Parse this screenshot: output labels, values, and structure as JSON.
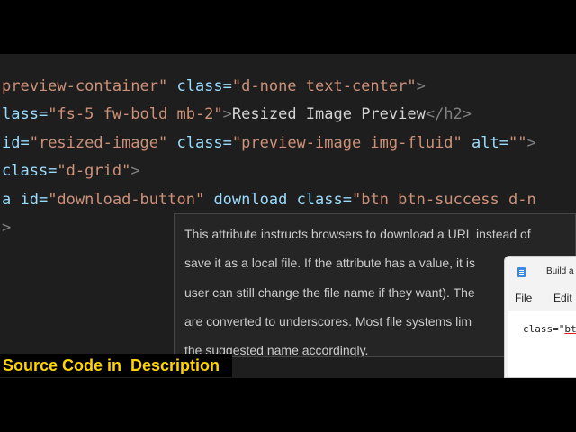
{
  "editor": {
    "lines": [
      [
        "preview-container\"",
        " class=",
        "\"d-none text-center\"",
        ">"
      ],
      [
        "lass=",
        "\"fs-5 fw-bold mb-2\"",
        ">",
        "Resized Image Preview",
        "</h2>"
      ],
      [
        "id=",
        "\"resized-image\"",
        " class=",
        "\"preview-image img-fluid\"",
        " alt=",
        "\"\"",
        ">"
      ],
      [
        "class=",
        "\"d-grid\"",
        ">"
      ],
      [
        "a id=",
        "\"download-button\"",
        " ",
        "download",
        " class=",
        "\"btn btn-success d-n"
      ],
      [
        ">"
      ]
    ]
  },
  "tooltip": {
    "lines": [
      "This attribute instructs browsers to download a URL instead of",
      "save it as a local file. If the attribute has a value, it is",
      "user can still change the file name if they want). The",
      "are converted to underscores. Most file systems lim",
      "the suggested name accordingly."
    ]
  },
  "notepad": {
    "title": "Build a",
    "menu": {
      "file": "File",
      "edit": "Edit"
    },
    "code_prefix": "class=\"",
    "code_underlined": "bt"
  },
  "banner": {
    "text": "Source Code in  Description",
    "color": "#ffd400"
  },
  "colors": {
    "editor_bg": "#1e1e1e",
    "attr": "#9cdcfe",
    "string": "#ce9178",
    "tooltip_bg": "#252526"
  }
}
